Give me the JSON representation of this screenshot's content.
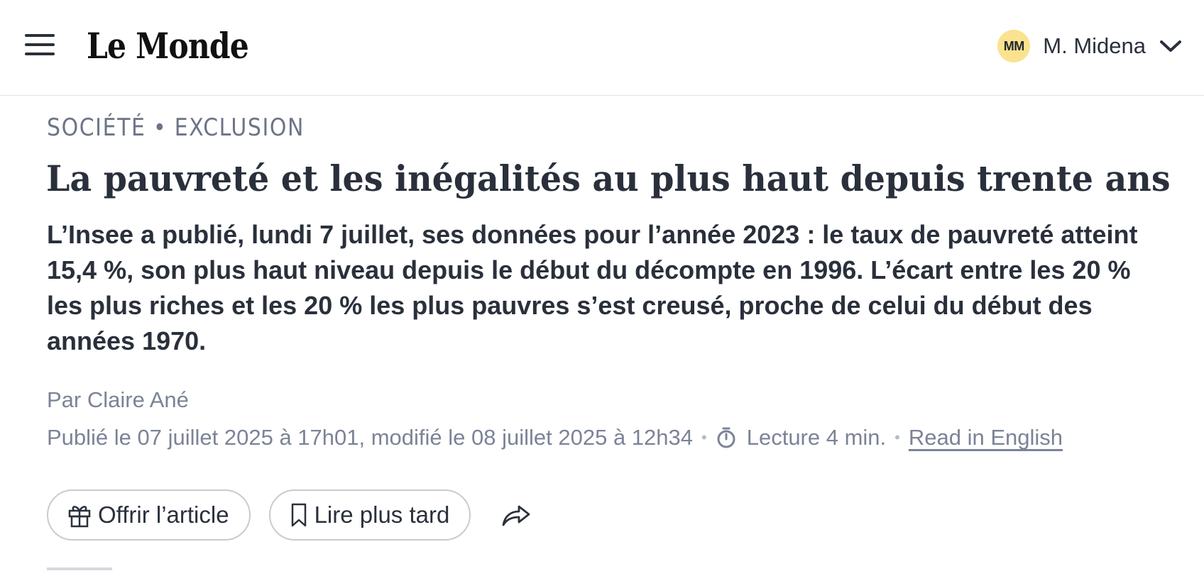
{
  "header": {
    "logo_text": "Le Monde",
    "user": {
      "initials": "MM",
      "name": "M. Midena"
    }
  },
  "article": {
    "kicker": {
      "section": "SOCIÉTÉ",
      "separator": "•",
      "tag": "EXCLUSION"
    },
    "headline": "La pauvreté et les inégalités au plus haut depuis trente ans",
    "lede": "L’Insee a publié, lundi 7 juillet, ses données pour l’année 2023 : le taux de pauvreté atteint 15,4 %, son plus haut niveau depuis le début du décompte en 1996. L’écart entre les 20 % les plus riches et les 20 % les plus pauvres s’est creusé, proche de celui du début des années 1970.",
    "byline": "Par Claire Ané",
    "published": "Publié le 07 juillet 2025 à 17h01, modifié le 08 juillet 2025 à 12h34",
    "meta_separator": "•",
    "reading_time": "Lecture 4 min.",
    "read_in_english": "Read in English"
  },
  "actions": {
    "gift_label": "Offrir l’article",
    "save_label": "Lire plus tard"
  },
  "icons": {
    "menu": "hamburger-menu-icon",
    "chevron": "chevron-down-icon",
    "clock": "stopwatch-icon",
    "gift": "gift-icon",
    "bookmark": "bookmark-icon",
    "share": "share-arrow-icon"
  },
  "colors": {
    "text_primary": "#2a303b",
    "text_muted": "#7b8396",
    "avatar_bg": "#fbe28e",
    "border": "#c9cbd0"
  }
}
